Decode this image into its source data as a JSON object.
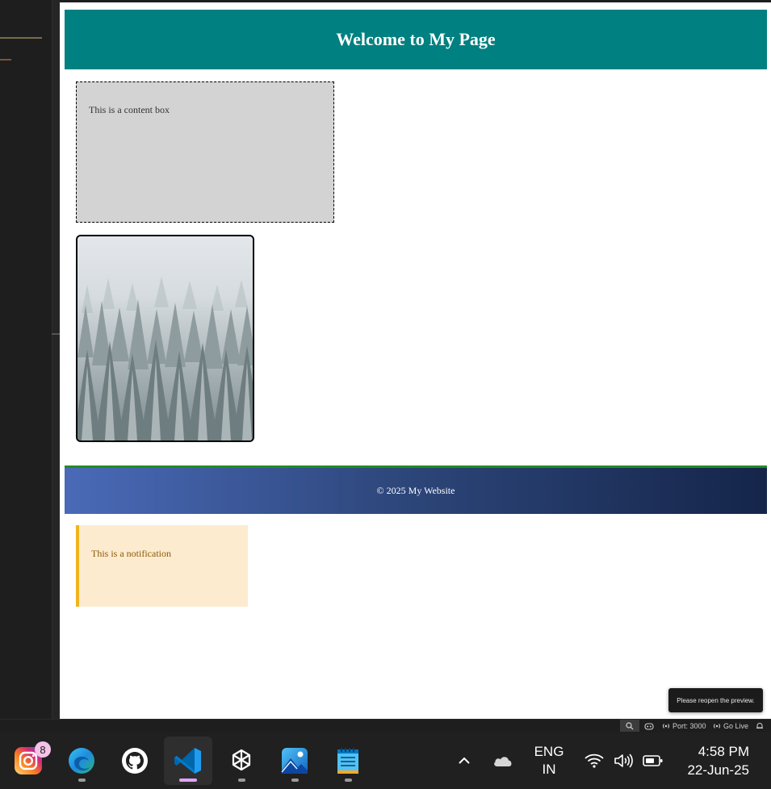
{
  "preview": {
    "header_title": "Welcome to My Page",
    "content_box_text": "This is a content box",
    "footer_text": "© 2025 My Website",
    "notification_text": "This is a notification",
    "toast_text": "Please reopen the preview."
  },
  "statusbar": {
    "port_label": "Port: 3000",
    "golive_label": "Go Live"
  },
  "taskbar": {
    "apps": [
      {
        "name": "Instagram",
        "icon": "instagram-icon",
        "badge": "8"
      },
      {
        "name": "Microsoft Edge",
        "icon": "edge-icon"
      },
      {
        "name": "GitHub Desktop",
        "icon": "github-icon"
      },
      {
        "name": "Visual Studio Code",
        "icon": "vscode-icon",
        "active": true
      },
      {
        "name": "ChatGPT",
        "icon": "chatgpt-icon"
      },
      {
        "name": "Photos",
        "icon": "photos-icon"
      },
      {
        "name": "Notepad",
        "icon": "notepad-icon"
      }
    ],
    "lang_line1": "ENG",
    "lang_line2": "IN",
    "time": "4:58 PM",
    "date": "22-Jun-25"
  },
  "colors": {
    "header_bg": "#008080",
    "content_box_bg": "#d3d3d3",
    "footer_border": "#228b22",
    "notification_bg": "#fdebd0",
    "notification_border": "#f0b41e",
    "vscode_active_indicator": "#e0a3ff"
  }
}
